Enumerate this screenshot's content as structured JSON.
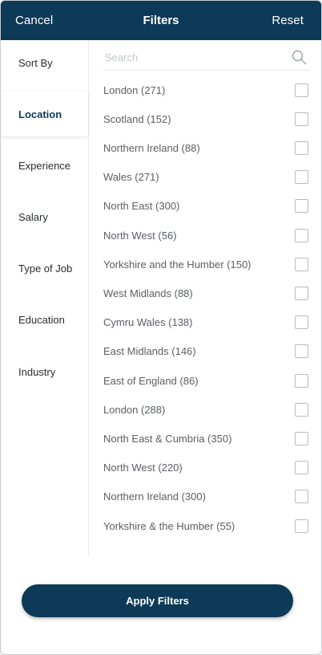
{
  "header": {
    "cancel_label": "Cancel",
    "title": "Filters",
    "reset_label": "Reset"
  },
  "sidebar": {
    "items": [
      {
        "label": "Sort By",
        "active": false
      },
      {
        "label": "Location",
        "active": true
      },
      {
        "label": "Experience",
        "active": false
      },
      {
        "label": "Salary",
        "active": false
      },
      {
        "label": "Type of Job",
        "active": false
      },
      {
        "label": "Education",
        "active": false
      },
      {
        "label": "Industry",
        "active": false
      }
    ]
  },
  "search": {
    "placeholder": "Search",
    "icon": "search-icon"
  },
  "locations": [
    {
      "label": "London (271)",
      "checked": false
    },
    {
      "label": "Scotland (152)",
      "checked": false
    },
    {
      "label": "Northern Ireland (88)",
      "checked": false
    },
    {
      "label": "Wales (271)",
      "checked": false
    },
    {
      "label": "North East (300)",
      "checked": false
    },
    {
      "label": "North West (56)",
      "checked": false
    },
    {
      "label": "Yorkshire and the Humber (150)",
      "checked": false
    },
    {
      "label": "West Midlands (88)",
      "checked": false
    },
    {
      "label": "Cymru Wales (138)",
      "checked": false
    },
    {
      "label": "East Midlands (146)",
      "checked": false
    },
    {
      "label": "East of England (86)",
      "checked": false
    },
    {
      "label": "London (288)",
      "checked": false
    },
    {
      "label": "North East & Cumbria (350)",
      "checked": false
    },
    {
      "label": "North West (220)",
      "checked": false
    },
    {
      "label": "Northern Ireland (300)",
      "checked": false
    },
    {
      "label": "Yorkshire & the Humber (55)",
      "checked": false
    }
  ],
  "apply_label": "Apply Filters",
  "colors": {
    "primary": "#0c3a57",
    "text": "#2a2d31",
    "muted": "#5b5e63",
    "checkbox_border": "#b9bcc0"
  }
}
